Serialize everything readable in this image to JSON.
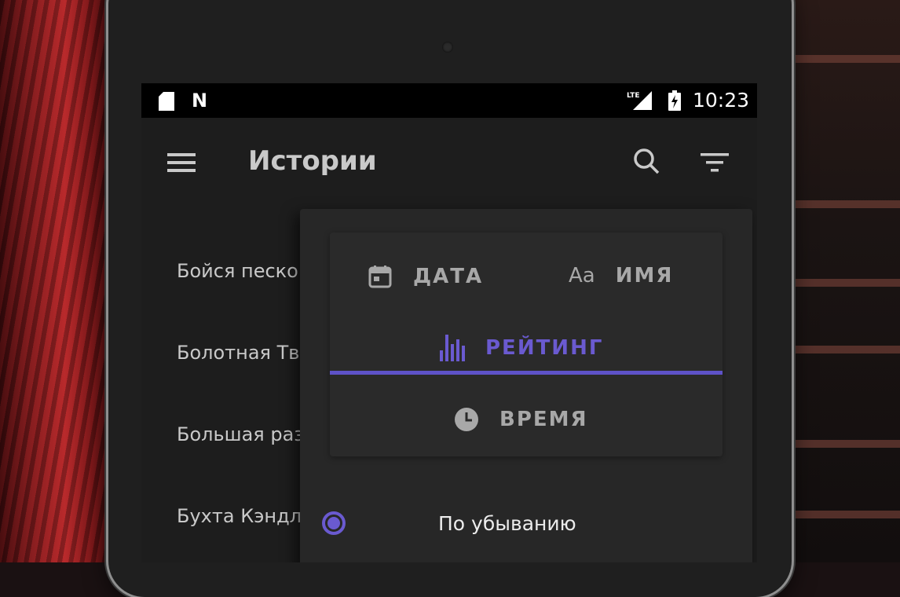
{
  "status_bar": {
    "network_icon": "n-icon",
    "time": "10:23"
  },
  "app_bar": {
    "title": "Истории"
  },
  "stories": [
    "Бойся песко",
    "Болотная Тв",
    "Большая раз",
    "Бухта Кэндл"
  ],
  "sort_menu": {
    "tabs": [
      {
        "label": "ДАТА",
        "icon": "calendar-icon"
      },
      {
        "label": "ИМЯ",
        "icon_text": "Aa"
      },
      {
        "label": "РЕЙТИНГ",
        "icon": "bar-chart-icon",
        "selected": true
      },
      {
        "label": "ВРЕМЯ",
        "icon": "clock-icon"
      }
    ],
    "order_option": {
      "label": "По убыванию",
      "selected": true
    }
  },
  "colors": {
    "accent": "#6a5ad0",
    "background": "#1d1d1d",
    "status_bar": "#000000"
  }
}
